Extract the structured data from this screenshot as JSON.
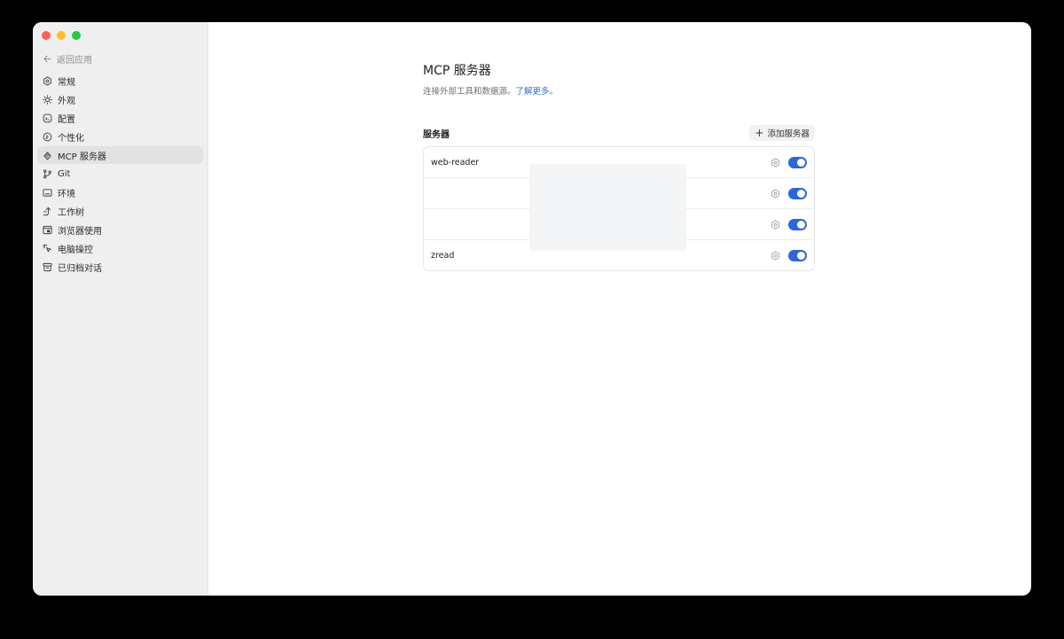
{
  "sidebar": {
    "back_label": "返回应用",
    "items": [
      {
        "label": "常规",
        "icon": "gear-icon"
      },
      {
        "label": "外观",
        "icon": "sun-icon"
      },
      {
        "label": "配置",
        "icon": "config-icon"
      },
      {
        "label": "个性化",
        "icon": "personalize-icon"
      },
      {
        "label": "MCP 服务器",
        "icon": "mcp-icon",
        "active": true
      },
      {
        "label": "Git",
        "icon": "git-branch-icon"
      },
      {
        "label": "环境",
        "icon": "terminal-icon"
      },
      {
        "label": "工作树",
        "icon": "worktree-icon"
      },
      {
        "label": "浏览器使用",
        "icon": "browser-icon"
      },
      {
        "label": "电脑操控",
        "icon": "cursor-icon"
      },
      {
        "label": "已归档对话",
        "icon": "archive-icon"
      }
    ]
  },
  "main": {
    "title": "MCP 服务器",
    "subtitle": "连接外部工具和数据源。",
    "learn_more": "了解更多",
    "subtitle_end": "。",
    "section_title": "服务器",
    "add_button": "添加服务器",
    "servers": [
      {
        "name": "web-reader",
        "enabled": true
      },
      {
        "name": "",
        "enabled": true
      },
      {
        "name": "",
        "enabled": true
      },
      {
        "name": "zread",
        "enabled": true
      }
    ]
  },
  "colors": {
    "accent": "#2b67d8",
    "link": "#2f6fd6",
    "sidebar_bg": "#efeff0"
  }
}
